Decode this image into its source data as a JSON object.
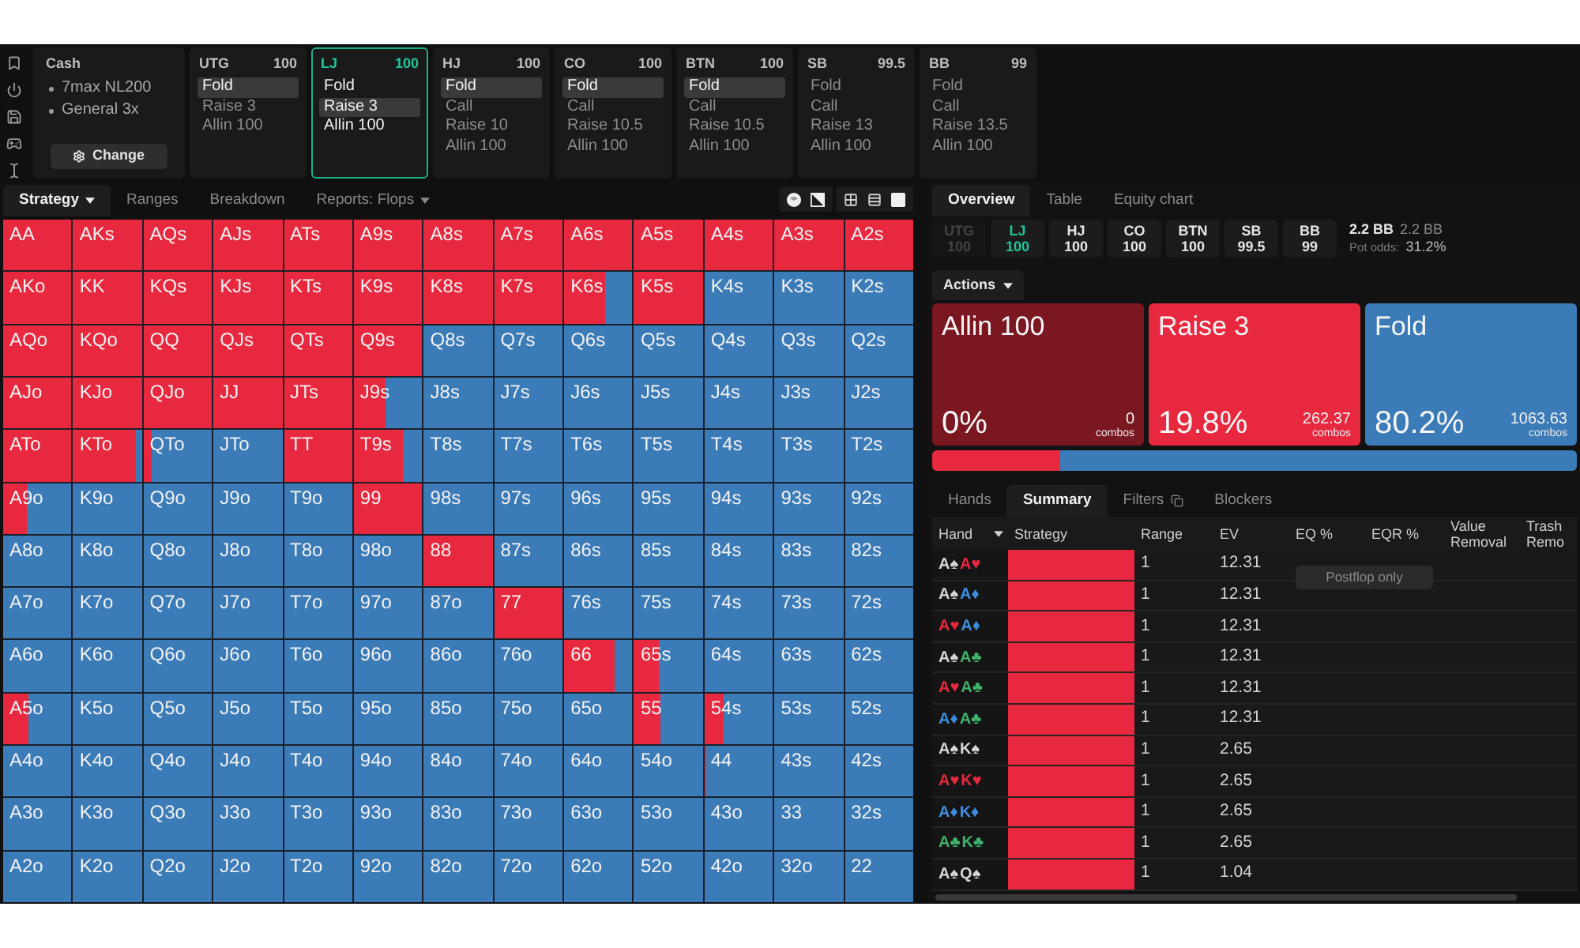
{
  "game": {
    "title": "Cash",
    "details": [
      "7max NL200",
      "General 3x"
    ],
    "button": "Change"
  },
  "positions": [
    {
      "name": "UTG",
      "stack": "100",
      "active": false,
      "actions": [
        {
          "label": "Fold",
          "selected": true
        },
        {
          "label": "Raise 3",
          "selected": false
        },
        {
          "label": "Allin 100",
          "selected": false
        }
      ]
    },
    {
      "name": "LJ",
      "stack": "100",
      "active": true,
      "actions": [
        {
          "label": "Fold",
          "selected": false
        },
        {
          "label": "Raise 3",
          "selected": true
        },
        {
          "label": "Allin 100",
          "selected": false
        }
      ]
    },
    {
      "name": "HJ",
      "stack": "100",
      "active": false,
      "actions": [
        {
          "label": "Fold",
          "selected": true
        },
        {
          "label": "Call",
          "selected": false
        },
        {
          "label": "Raise 10",
          "selected": false
        },
        {
          "label": "Allin 100",
          "selected": false
        }
      ]
    },
    {
      "name": "CO",
      "stack": "100",
      "active": false,
      "actions": [
        {
          "label": "Fold",
          "selected": true
        },
        {
          "label": "Call",
          "selected": false
        },
        {
          "label": "Raise 10.5",
          "selected": false
        },
        {
          "label": "Allin 100",
          "selected": false
        }
      ]
    },
    {
      "name": "BTN",
      "stack": "100",
      "active": false,
      "actions": [
        {
          "label": "Fold",
          "selected": true
        },
        {
          "label": "Call",
          "selected": false
        },
        {
          "label": "Raise 10.5",
          "selected": false
        },
        {
          "label": "Allin 100",
          "selected": false
        }
      ]
    },
    {
      "name": "SB",
      "stack": "99.5",
      "active": false,
      "actions": [
        {
          "label": "Fold",
          "selected": false
        },
        {
          "label": "Call",
          "selected": false
        },
        {
          "label": "Raise 13",
          "selected": false
        },
        {
          "label": "Allin 100",
          "selected": false
        }
      ]
    },
    {
      "name": "BB",
      "stack": "99",
      "active": false,
      "actions": [
        {
          "label": "Fold",
          "selected": false
        },
        {
          "label": "Call",
          "selected": false
        },
        {
          "label": "Raise 13.5",
          "selected": false
        },
        {
          "label": "Allin 100",
          "selected": false
        }
      ]
    }
  ],
  "strategy_tabs": [
    {
      "label": "Strategy",
      "selected": true,
      "kind": "dropdown"
    },
    {
      "label": "Ranges",
      "selected": false,
      "kind": "plain"
    },
    {
      "label": "Breakdown",
      "selected": false,
      "kind": "plain"
    },
    {
      "label": "Reports: Flops",
      "selected": false,
      "kind": "dropdown"
    }
  ],
  "grid": {
    "rows": [
      {
        "cells": [
          {
            "hand": "AA",
            "level": 1
          },
          {
            "hand": "AKs",
            "level": 1
          },
          {
            "hand": "AQs",
            "level": 1
          },
          {
            "hand": "AJs",
            "level": 1
          },
          {
            "hand": "ATs",
            "level": 1
          },
          {
            "hand": "A9s",
            "level": 1
          },
          {
            "hand": "A8s",
            "level": 1
          },
          {
            "hand": "A7s",
            "level": 1
          },
          {
            "hand": "A6s",
            "level": 1
          },
          {
            "hand": "A5s",
            "level": 1
          },
          {
            "hand": "A4s",
            "level": 1
          },
          {
            "hand": "A3s",
            "level": 1
          },
          {
            "hand": "A2s",
            "level": 1
          }
        ]
      },
      {
        "cells": [
          {
            "hand": "AKo",
            "level": 1
          },
          {
            "hand": "KK",
            "level": 1
          },
          {
            "hand": "KQs",
            "level": 1
          },
          {
            "hand": "KJs",
            "level": 1
          },
          {
            "hand": "KTs",
            "level": 1
          },
          {
            "hand": "K9s",
            "level": 1
          },
          {
            "hand": "K8s",
            "level": 1
          },
          {
            "hand": "K7s",
            "level": 1
          },
          {
            "hand": "K6s",
            "level": 0.6
          },
          {
            "hand": "K5s",
            "level": 1
          },
          {
            "hand": "K4s"
          },
          {
            "hand": "K3s"
          },
          {
            "hand": "K2s"
          }
        ]
      },
      {
        "cells": [
          {
            "hand": "AQo",
            "level": 1
          },
          {
            "hand": "KQo",
            "level": 1
          },
          {
            "hand": "QQ",
            "level": 1
          },
          {
            "hand": "QJs",
            "level": 1
          },
          {
            "hand": "QTs",
            "level": 1
          },
          {
            "hand": "Q9s",
            "level": 1
          },
          {
            "hand": "Q8s"
          },
          {
            "hand": "Q7s"
          },
          {
            "hand": "Q6s"
          },
          {
            "hand": "Q5s"
          },
          {
            "hand": "Q4s"
          },
          {
            "hand": "Q3s"
          },
          {
            "hand": "Q2s"
          }
        ]
      },
      {
        "cells": [
          {
            "hand": "AJo",
            "level": 1
          },
          {
            "hand": "KJo",
            "level": 1
          },
          {
            "hand": "QJo",
            "level": 1
          },
          {
            "hand": "JJ",
            "level": 1
          },
          {
            "hand": "JTs",
            "level": 1
          },
          {
            "hand": "J9s",
            "level": 0.47
          },
          {
            "hand": "J8s"
          },
          {
            "hand": "J7s"
          },
          {
            "hand": "J6s"
          },
          {
            "hand": "J5s"
          },
          {
            "hand": "J4s"
          },
          {
            "hand": "J3s"
          },
          {
            "hand": "J2s"
          }
        ]
      },
      {
        "cells": [
          {
            "hand": "ATo",
            "level": 1
          },
          {
            "hand": "KTo",
            "level": 0.92
          },
          {
            "hand": "QTo",
            "level": 0.13
          },
          {
            "hand": "JTo"
          },
          {
            "hand": "TT",
            "level": 1
          },
          {
            "hand": "T9s",
            "level": 0.71
          },
          {
            "hand": "T8s"
          },
          {
            "hand": "T7s"
          },
          {
            "hand": "T6s"
          },
          {
            "hand": "T5s"
          },
          {
            "hand": "T4s"
          },
          {
            "hand": "T3s"
          },
          {
            "hand": "T2s"
          }
        ]
      },
      {
        "cells": [
          {
            "hand": "A9o",
            "level": 0.34
          },
          {
            "hand": "K9o"
          },
          {
            "hand": "Q9o"
          },
          {
            "hand": "J9o"
          },
          {
            "hand": "T9o"
          },
          {
            "hand": "99",
            "level": 1
          },
          {
            "hand": "98s"
          },
          {
            "hand": "97s"
          },
          {
            "hand": "96s"
          },
          {
            "hand": "95s"
          },
          {
            "hand": "94s"
          },
          {
            "hand": "93s"
          },
          {
            "hand": "92s"
          }
        ]
      },
      {
        "cells": [
          {
            "hand": "A8o"
          },
          {
            "hand": "K8o"
          },
          {
            "hand": "Q8o"
          },
          {
            "hand": "J8o"
          },
          {
            "hand": "T8o"
          },
          {
            "hand": "98o"
          },
          {
            "hand": "88",
            "level": 1
          },
          {
            "hand": "87s"
          },
          {
            "hand": "86s"
          },
          {
            "hand": "85s"
          },
          {
            "hand": "84s"
          },
          {
            "hand": "83s"
          },
          {
            "hand": "82s"
          }
        ]
      },
      {
        "cells": [
          {
            "hand": "A7o"
          },
          {
            "hand": "K7o"
          },
          {
            "hand": "Q7o"
          },
          {
            "hand": "J7o"
          },
          {
            "hand": "T7o"
          },
          {
            "hand": "97o"
          },
          {
            "hand": "87o"
          },
          {
            "hand": "77",
            "level": 1
          },
          {
            "hand": "76s"
          },
          {
            "hand": "75s"
          },
          {
            "hand": "74s"
          },
          {
            "hand": "73s"
          },
          {
            "hand": "72s"
          }
        ]
      },
      {
        "cells": [
          {
            "hand": "A6o"
          },
          {
            "hand": "K6o"
          },
          {
            "hand": "Q6o"
          },
          {
            "hand": "J6o"
          },
          {
            "hand": "T6o"
          },
          {
            "hand": "96o"
          },
          {
            "hand": "86o"
          },
          {
            "hand": "76o"
          },
          {
            "hand": "66",
            "level": 0.73
          },
          {
            "hand": "65s",
            "level": 0.35
          },
          {
            "hand": "64s"
          },
          {
            "hand": "63s"
          },
          {
            "hand": "62s"
          }
        ]
      },
      {
        "cells": [
          {
            "hand": "A5o",
            "level": 0.36
          },
          {
            "hand": "K5o"
          },
          {
            "hand": "Q5o"
          },
          {
            "hand": "J5o"
          },
          {
            "hand": "T5o"
          },
          {
            "hand": "95o"
          },
          {
            "hand": "85o"
          },
          {
            "hand": "75o"
          },
          {
            "hand": "65o"
          },
          {
            "hand": "55",
            "level": 0.38
          },
          {
            "hand": "54s",
            "level": 0.27
          },
          {
            "hand": "53s"
          },
          {
            "hand": "52s"
          }
        ]
      },
      {
        "cells": [
          {
            "hand": "A4o"
          },
          {
            "hand": "K4o"
          },
          {
            "hand": "Q4o"
          },
          {
            "hand": "J4o"
          },
          {
            "hand": "T4o"
          },
          {
            "hand": "94o"
          },
          {
            "hand": "84o"
          },
          {
            "hand": "74o"
          },
          {
            "hand": "64o"
          },
          {
            "hand": "54o"
          },
          {
            "hand": "44",
            "level": 0.02
          },
          {
            "hand": "43s"
          },
          {
            "hand": "42s"
          }
        ]
      },
      {
        "cells": [
          {
            "hand": "A3o"
          },
          {
            "hand": "K3o"
          },
          {
            "hand": "Q3o"
          },
          {
            "hand": "J3o"
          },
          {
            "hand": "T3o"
          },
          {
            "hand": "93o"
          },
          {
            "hand": "83o"
          },
          {
            "hand": "73o"
          },
          {
            "hand": "63o"
          },
          {
            "hand": "53o"
          },
          {
            "hand": "43o"
          },
          {
            "hand": "33"
          },
          {
            "hand": "32s"
          }
        ]
      },
      {
        "cells": [
          {
            "hand": "A2o"
          },
          {
            "hand": "K2o"
          },
          {
            "hand": "Q2o"
          },
          {
            "hand": "J2o"
          },
          {
            "hand": "T2o"
          },
          {
            "hand": "92o"
          },
          {
            "hand": "82o"
          },
          {
            "hand": "72o"
          },
          {
            "hand": "62o"
          },
          {
            "hand": "52o"
          },
          {
            "hand": "42o"
          },
          {
            "hand": "32o"
          },
          {
            "hand": "22"
          }
        ]
      }
    ]
  },
  "overview_tabs": [
    {
      "label": "Overview",
      "selected": true
    },
    {
      "label": "Table",
      "selected": false
    },
    {
      "label": "Equity chart",
      "selected": false
    }
  ],
  "seats": [
    {
      "name": "UTG",
      "stack": "100",
      "selected": false,
      "disabled": true
    },
    {
      "name": "LJ",
      "stack": "100",
      "selected": true,
      "disabled": false
    },
    {
      "name": "HJ",
      "stack": "100",
      "selected": false,
      "disabled": false
    },
    {
      "name": "CO",
      "stack": "100",
      "selected": false,
      "disabled": false
    },
    {
      "name": "BTN",
      "stack": "100",
      "selected": false,
      "disabled": false
    },
    {
      "name": "SB",
      "stack": "99.5",
      "selected": false,
      "disabled": false
    },
    {
      "name": "BB",
      "stack": "99",
      "selected": false,
      "disabled": false
    }
  ],
  "pot": {
    "primary": "2.2 BB",
    "secondary": "2.2 BB",
    "odds_label": "Pot odds:",
    "odds": "31.2%"
  },
  "actions_menu": "Actions",
  "actions": [
    {
      "name": "Allin 100",
      "percent": "0%",
      "combos": "0",
      "combos_label": "combos",
      "color": "#7b1721"
    },
    {
      "name": "Raise 3",
      "percent": "19.8%",
      "combos": "262.37",
      "combos_label": "combos",
      "color": "#e8283e"
    },
    {
      "name": "Fold",
      "percent": "80.2%",
      "combos": "1063.63",
      "combos_label": "combos",
      "color": "#3b7bb7"
    }
  ],
  "strategy_bar": [
    {
      "level": 0.198,
      "color": "#e8283e"
    },
    {
      "level": 0.802,
      "color": "#3b7bb7"
    }
  ],
  "hand_tabs": [
    {
      "label": "Hands",
      "selected": false,
      "kind": "plain"
    },
    {
      "label": "Summary",
      "selected": true,
      "kind": "plain"
    },
    {
      "label": "Filters",
      "selected": false,
      "kind": "icon"
    },
    {
      "label": "Blockers",
      "selected": false,
      "kind": "plain"
    }
  ],
  "table": {
    "columns": [
      {
        "label": "Hand",
        "kind": "dropdown"
      },
      {
        "label": "Strategy",
        "kind": "plain"
      },
      {
        "label": "Range",
        "kind": "plain"
      },
      {
        "label": "EV",
        "kind": "plain"
      },
      {
        "label": "EQ %",
        "kind": "plain"
      },
      {
        "label": "EQR %",
        "kind": "plain"
      },
      {
        "label": "Value Removal",
        "kind": "plain"
      },
      {
        "label": "Trash Remo",
        "kind": "plain"
      }
    ],
    "note_button": "Postflop only",
    "rows": [
      {
        "cards": [
          {
            "text": "A♠",
            "color": "#d6d6d6"
          },
          {
            "text": "A♥",
            "color": "#e8283e"
          }
        ],
        "level": 1,
        "range": "1",
        "ev": "12.31"
      },
      {
        "cards": [
          {
            "text": "A♠",
            "color": "#d6d6d6"
          },
          {
            "text": "A♦",
            "color": "#3d8ee0"
          }
        ],
        "level": 1,
        "range": "1",
        "ev": "12.31"
      },
      {
        "cards": [
          {
            "text": "A♥",
            "color": "#e8283e"
          },
          {
            "text": "A♦",
            "color": "#3d8ee0"
          }
        ],
        "level": 1,
        "range": "1",
        "ev": "12.31"
      },
      {
        "cards": [
          {
            "text": "A♠",
            "color": "#d6d6d6"
          },
          {
            "text": "A♣",
            "color": "#3fb36a"
          }
        ],
        "level": 1,
        "range": "1",
        "ev": "12.31"
      },
      {
        "cards": [
          {
            "text": "A♥",
            "color": "#e8283e"
          },
          {
            "text": "A♣",
            "color": "#3fb36a"
          }
        ],
        "level": 1,
        "range": "1",
        "ev": "12.31"
      },
      {
        "cards": [
          {
            "text": "A♦",
            "color": "#3d8ee0"
          },
          {
            "text": "A♣",
            "color": "#3fb36a"
          }
        ],
        "level": 1,
        "range": "1",
        "ev": "12.31"
      },
      {
        "cards": [
          {
            "text": "A♠",
            "color": "#d6d6d6"
          },
          {
            "text": "K♠",
            "color": "#d6d6d6"
          }
        ],
        "level": 1,
        "range": "1",
        "ev": "2.65"
      },
      {
        "cards": [
          {
            "text": "A♥",
            "color": "#e8283e"
          },
          {
            "text": "K♥",
            "color": "#e8283e"
          }
        ],
        "level": 1,
        "range": "1",
        "ev": "2.65"
      },
      {
        "cards": [
          {
            "text": "A♦",
            "color": "#3d8ee0"
          },
          {
            "text": "K♦",
            "color": "#3d8ee0"
          }
        ],
        "level": 1,
        "range": "1",
        "ev": "2.65"
      },
      {
        "cards": [
          {
            "text": "A♣",
            "color": "#3fb36a"
          },
          {
            "text": "K♣",
            "color": "#3fb36a"
          }
        ],
        "level": 1,
        "range": "1",
        "ev": "2.65"
      },
      {
        "cards": [
          {
            "text": "A♠",
            "color": "#d6d6d6"
          },
          {
            "text": "Q♠",
            "color": "#d6d6d6"
          }
        ],
        "level": 1,
        "range": "1",
        "ev": "1.04"
      }
    ]
  }
}
